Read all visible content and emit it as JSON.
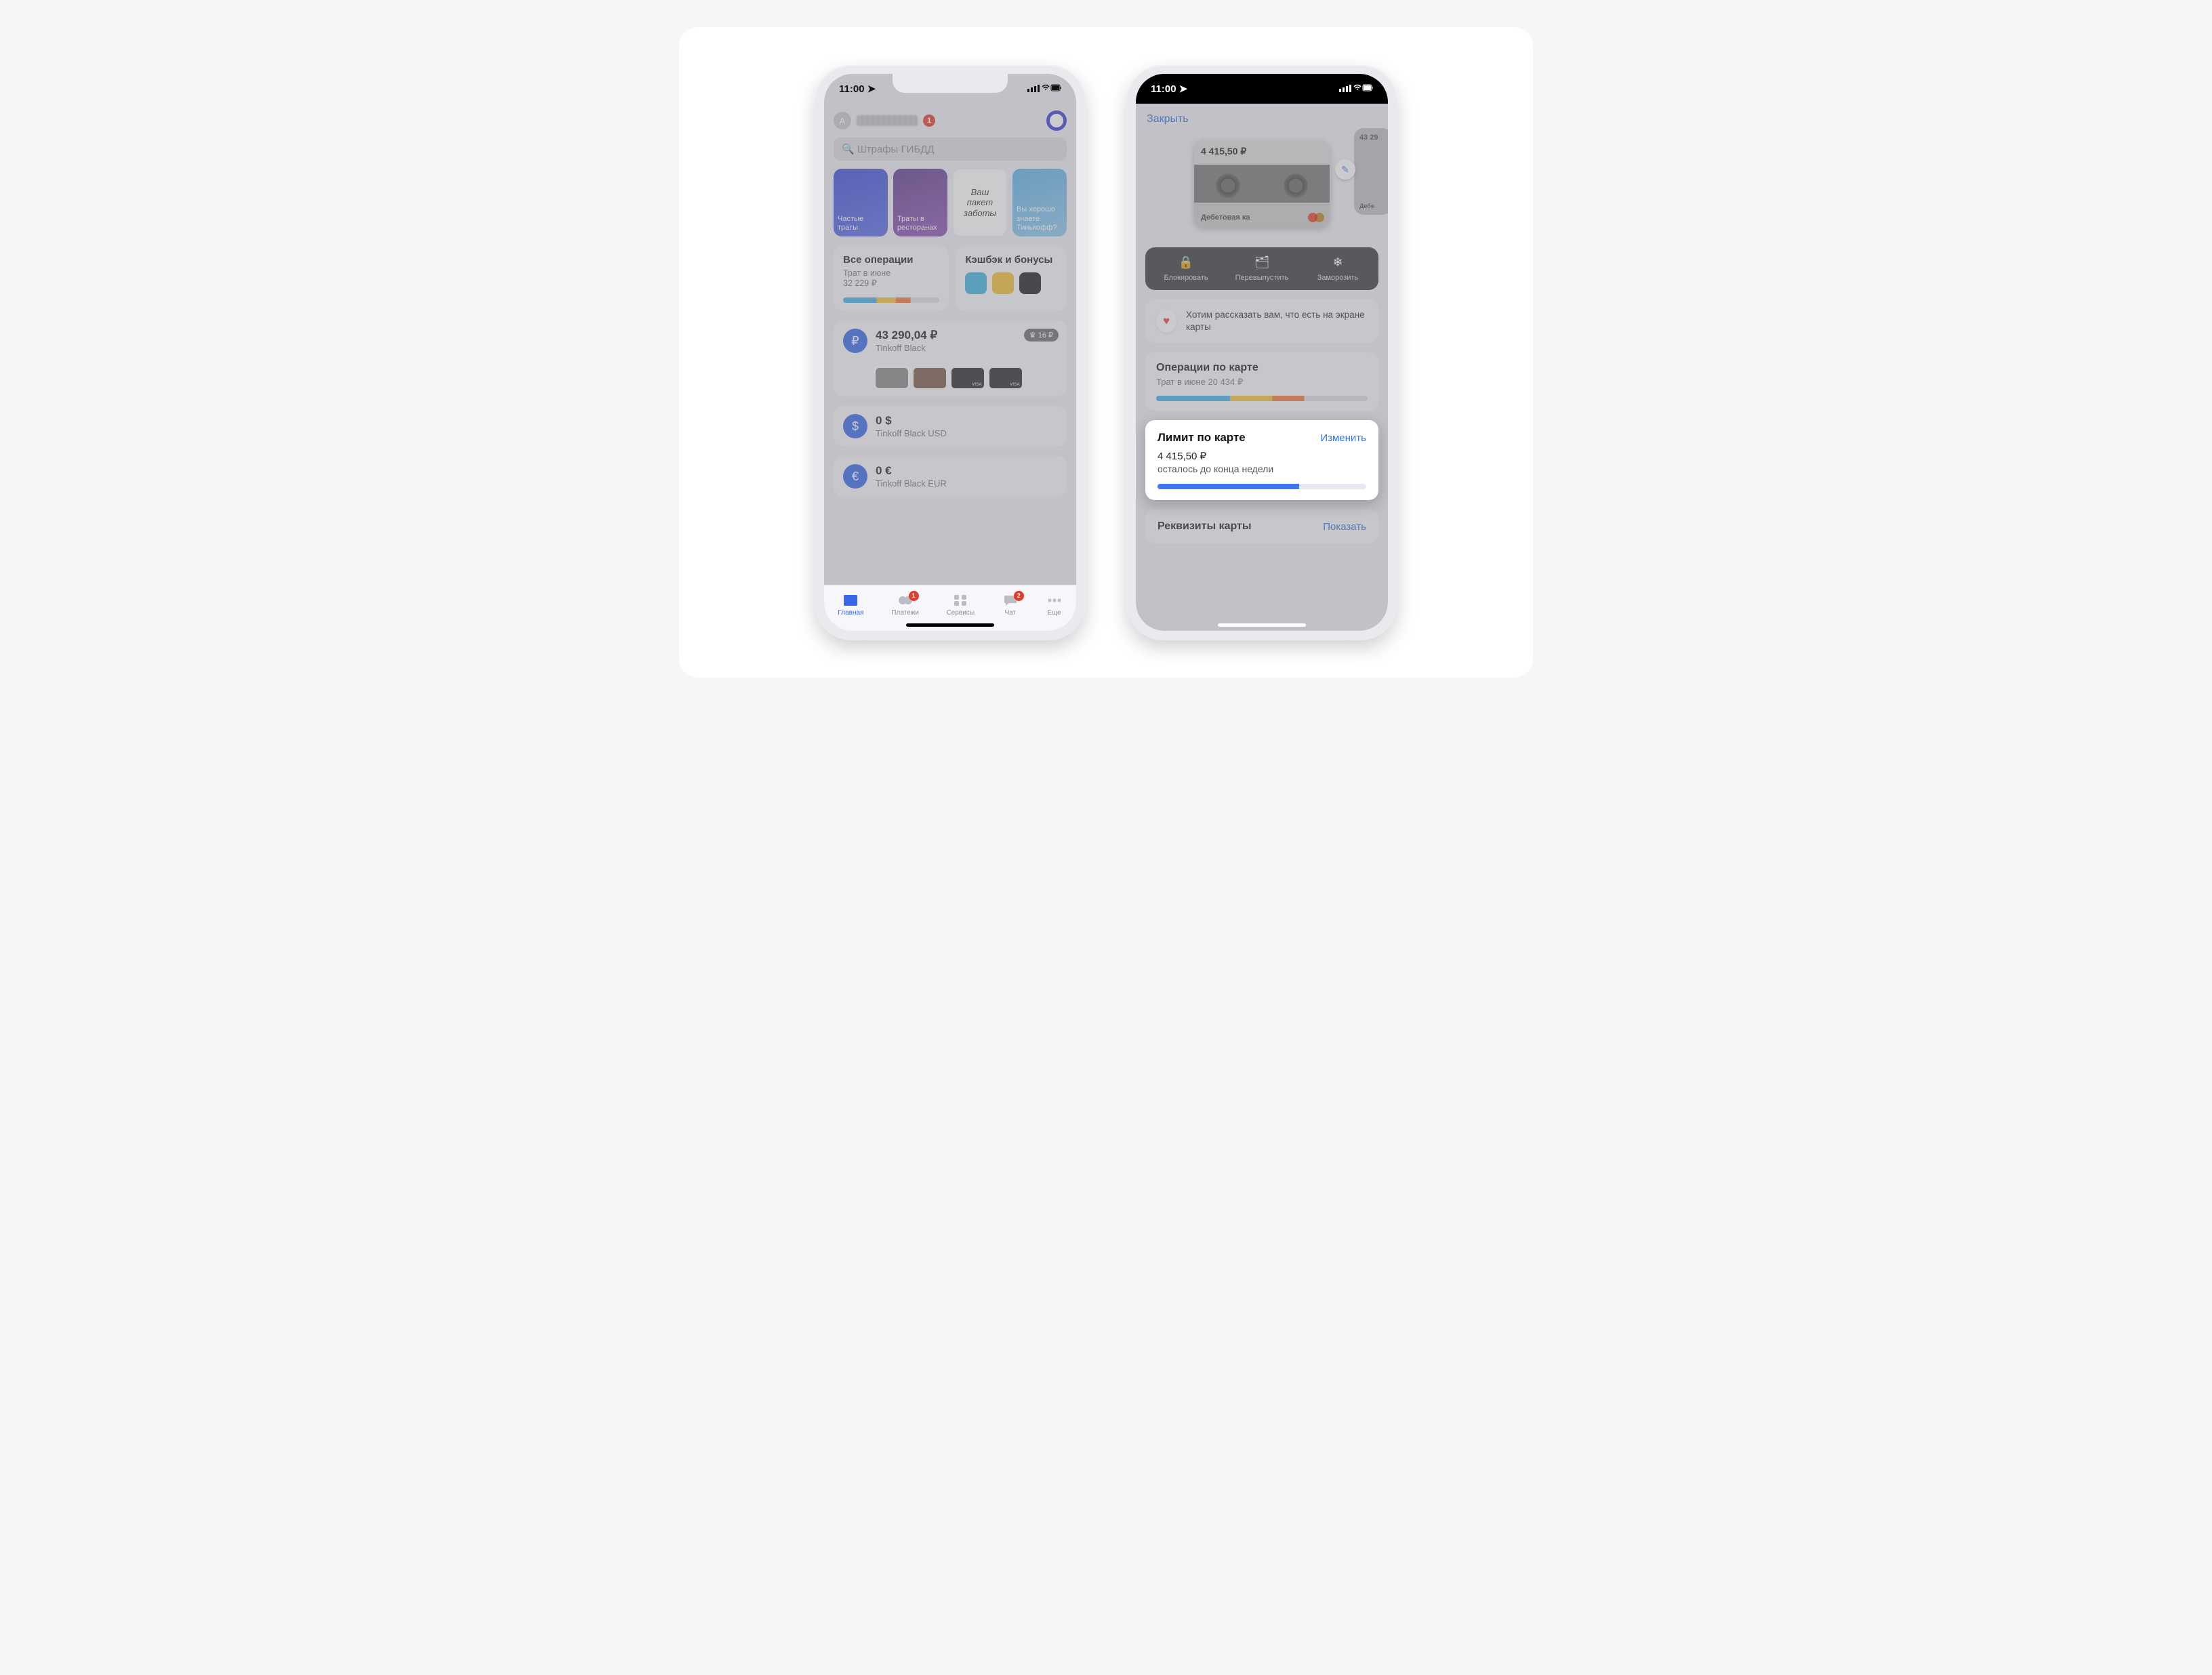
{
  "status": {
    "time": "11:00"
  },
  "phoneA": {
    "avatarLetter": "А",
    "notifCount": "1",
    "searchPlaceholder": "Штрафы ГИБДД",
    "stories": [
      {
        "label": "Частые траты"
      },
      {
        "label": "Траты в ресторанах"
      },
      {
        "label": "Ваш пакет заботы"
      },
      {
        "label": "Вы хорошо знаете Тинькофф?"
      }
    ],
    "allOps": {
      "title": "Все операции",
      "sub": "Трат в июне",
      "amount": "32 229 ₽"
    },
    "cashback": {
      "title": "Кэшбэк и бонусы",
      "colors": [
        "#3fb4e0",
        "#f1c233",
        "#1f1f24"
      ]
    },
    "accounts": [
      {
        "amount": "43 290,04 ₽",
        "name": "Tinkoff Black",
        "pill": "16 ₽",
        "iconBg": "#3668e8",
        "sym": "₽",
        "hasCards": true
      },
      {
        "amount": "0 $",
        "name": "Tinkoff Black USD",
        "iconBg": "#3668e8",
        "sym": "$"
      },
      {
        "amount": "0 €",
        "name": "Tinkoff Black EUR",
        "iconBg": "#3668e8",
        "sym": "€"
      }
    ],
    "tabs": [
      {
        "label": "Главная",
        "active": true
      },
      {
        "label": "Платежи",
        "badge": "1"
      },
      {
        "label": "Сервисы"
      },
      {
        "label": "Чат",
        "badge": "2"
      },
      {
        "label": "Еще"
      }
    ]
  },
  "phoneB": {
    "close": "Закрыть",
    "card": {
      "balance": "4 415,50 ₽",
      "type": "Дебетовая ка"
    },
    "peekBalance": "43 29",
    "peekType": "Дебе",
    "actions": [
      {
        "label": "Блокировать",
        "icon": "🔒"
      },
      {
        "label": "Перевыпустить",
        "icon": "🗂"
      },
      {
        "label": "Заморозить",
        "icon": "❄"
      }
    ],
    "info": "Хотим рассказать вам, что есть на экране карты",
    "ops": {
      "title": "Операции по карте",
      "sub": "Трат в июне 20 434 ₽"
    },
    "limit": {
      "title": "Лимит по карте",
      "change": "Изменить",
      "amount": "4 415,50 ₽",
      "remaining": "осталось до конца недели",
      "progressPct": 68
    },
    "req": {
      "title": "Реквизиты карты",
      "show": "Показать"
    }
  }
}
